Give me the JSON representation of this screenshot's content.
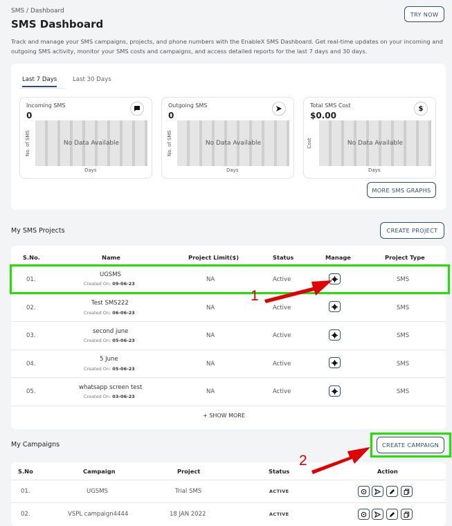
{
  "header": {
    "breadcrumb": "SMS / Dashboard",
    "title": "SMS Dashboard",
    "description": "Track and manage your SMS campaigns, projects, and phone numbers with the EnableX SMS Dashboard. Get real-time updates on your incoming and outgoing SMS activity, monitor your SMS costs and campaigns, and access detailed reports for the last 7 days and 30 days.",
    "try_now": "TRY NOW"
  },
  "tabs": [
    {
      "label": "Last 7 Days",
      "active": true
    },
    {
      "label": "Last 30 Days",
      "active": false
    }
  ],
  "stats": [
    {
      "label": "Incoming SMS",
      "value": "0",
      "icon": "message-icon",
      "ylabel": "No. of SMS",
      "xlabel": "Days",
      "empty": "No Data Available"
    },
    {
      "label": "Outgoing SMS",
      "value": "0",
      "icon": "send-icon",
      "ylabel": "No. of SMS",
      "xlabel": "Days",
      "empty": "No Data Available"
    },
    {
      "label": "Total SMS Cost",
      "value": "$0.00",
      "icon": "dollar-icon",
      "ylabel": "Cost",
      "xlabel": "Days",
      "empty": "No Data Available"
    }
  ],
  "more_graphs": "MORE SMS GRAPHS",
  "projects": {
    "title": "My SMS Projects",
    "create_label": "CREATE PROJECT",
    "columns": [
      "S.No.",
      "Name",
      "Project Limit($)",
      "Status",
      "Manage",
      "Project Type"
    ],
    "created_prefix": "Created On:",
    "rows": [
      {
        "sno": "01.",
        "name": "UGSMS",
        "created": "09-06-23",
        "limit": "NA",
        "status": "Active",
        "type": "SMS"
      },
      {
        "sno": "02.",
        "name": "Test SMS222",
        "created": "06-06-23",
        "limit": "NA",
        "status": "Active",
        "type": "SMS"
      },
      {
        "sno": "03.",
        "name": "second june",
        "created": "05-06-23",
        "limit": "NA",
        "status": "Active",
        "type": "SMS"
      },
      {
        "sno": "04.",
        "name": "5 June",
        "created": "05-06-23",
        "limit": "NA",
        "status": "Active",
        "type": "SMS"
      },
      {
        "sno": "05.",
        "name": "whatsapp screen test",
        "created": "03-06-23",
        "limit": "NA",
        "status": "Active",
        "type": "SMS"
      }
    ],
    "show_more": "+ SHOW MORE"
  },
  "campaigns": {
    "title": "My Campaigns",
    "create_label": "CREATE CAMPAIGN",
    "columns": [
      "S.No",
      "Campaign",
      "Project",
      "Status",
      "Action"
    ],
    "rows": [
      {
        "sno": "01.",
        "campaign": "UGSMS",
        "project": "Trial SMS",
        "status": "ACTIVE"
      },
      {
        "sno": "02.",
        "campaign": "VSPL campaign4444",
        "project": "18 JAN 2022",
        "status": "ACTIVE"
      }
    ]
  },
  "annotations": {
    "one": "1",
    "two": "2",
    "highlight_color": "#22e000",
    "arrow_color": "#e00000"
  }
}
